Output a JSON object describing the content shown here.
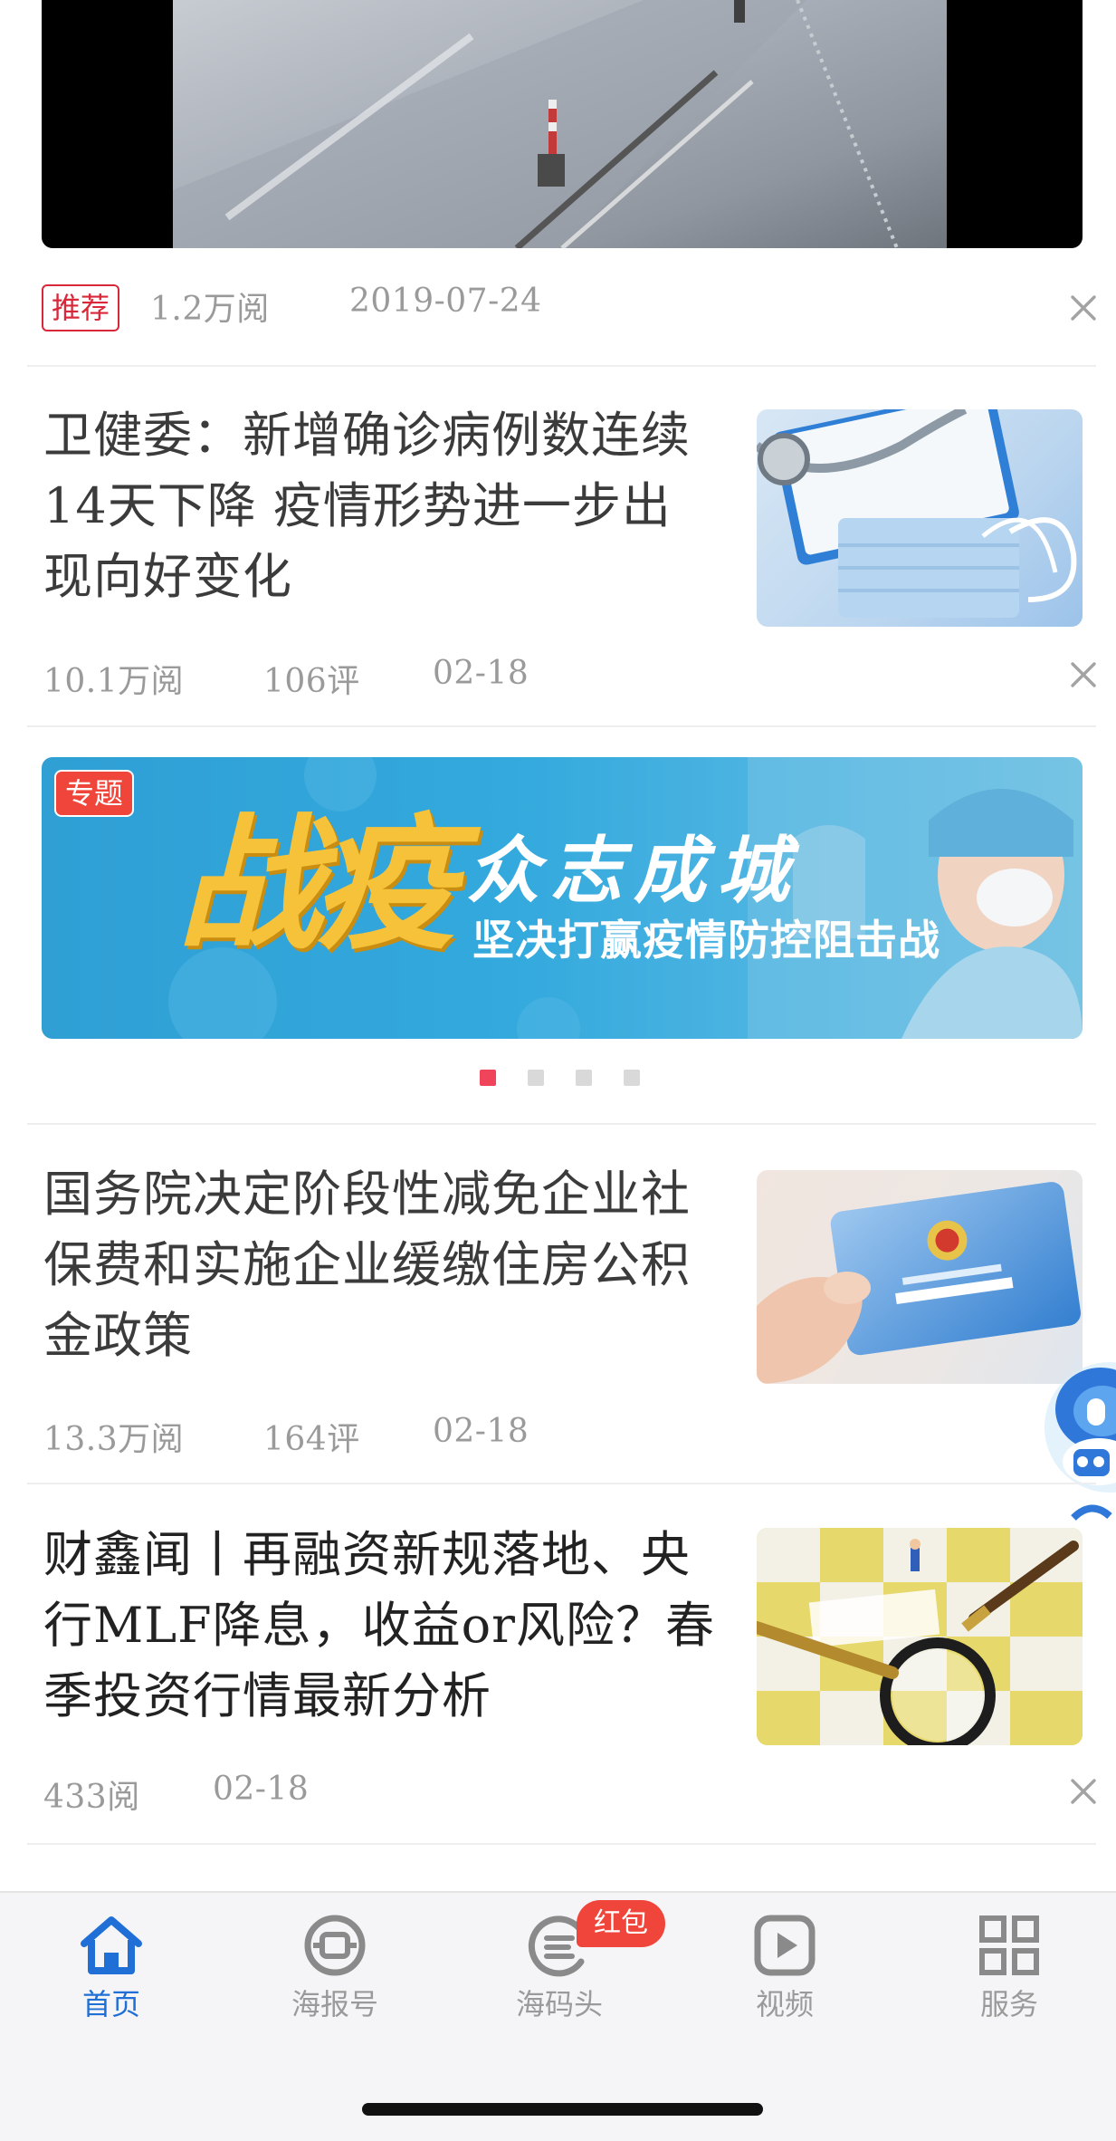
{
  "feed": {
    "video_item": {
      "tag": "推荐",
      "reads": "1.2万阅",
      "date": "2019-07-24"
    },
    "news": [
      {
        "title": "卫健委：新增确诊病例数连续14天下降  疫情形势进一步出现向好变化",
        "reads": "10.1万阅",
        "comments": "106评",
        "date": "02-18",
        "thumb": "medical-masks-stethoscope-image"
      },
      {
        "title": "国务院决定阶段性减免企业社保费和实施企业缓缴住房公积金政策",
        "reads": "13.3万阅",
        "comments": "164评",
        "date": "02-18",
        "thumb": "social-security-card-image"
      },
      {
        "title": "财鑫闻丨再融资新规落地、央行MLF降息，收益or风险？春季投资行情最新分析",
        "reads": "433阅",
        "comments": "",
        "date": "02-18",
        "thumb": "refinancing-puzzle-magnifier-image"
      }
    ],
    "banner": {
      "tag": "专题",
      "calligraphy": "战疫",
      "headline": "众志成城",
      "subline": "坚决打赢疫情防控阻击战",
      "dots_total": 4,
      "active_dot": 1
    }
  },
  "tabbar": {
    "items": [
      {
        "label": "首页",
        "icon": "home-icon",
        "active": true
      },
      {
        "label": "海报号",
        "icon": "haibao-icon",
        "active": false
      },
      {
        "label": "海码头",
        "icon": "haimatou-icon",
        "active": false
      },
      {
        "label": "视频",
        "icon": "video-play-icon",
        "active": false
      },
      {
        "label": "服务",
        "icon": "grid-services-icon",
        "active": false
      }
    ],
    "badge": "红包"
  },
  "colors": {
    "accent": "#1f6fd6",
    "tag_red": "#d8283a",
    "banner_blue": "#33a9dd",
    "dot_active": "#f0445a"
  }
}
